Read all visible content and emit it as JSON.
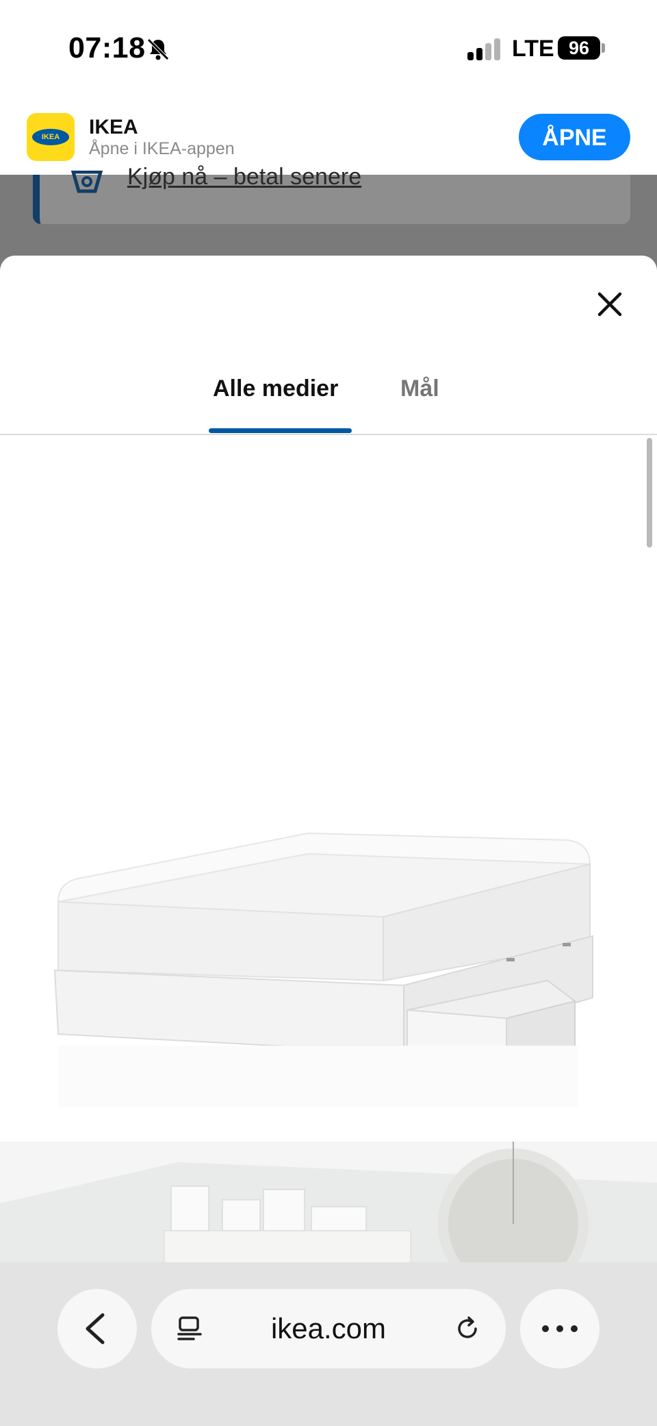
{
  "status_bar": {
    "time": "07:18",
    "network": "LTE",
    "battery": "96"
  },
  "app_banner": {
    "name": "IKEA",
    "subtitle": "Åpne i IKEA-appen",
    "open_label": "ÅPNE",
    "icon_text": "IKEA"
  },
  "background_page": {
    "link_text": "Kjøp nå – betal senere"
  },
  "modal": {
    "tabs": [
      {
        "label": "Alle medier",
        "active": true
      },
      {
        "label": "Mål",
        "active": false
      }
    ]
  },
  "browser": {
    "url": "ikea.com"
  },
  "colors": {
    "accent": "#0058a3",
    "open_button": "#0a84ff",
    "ikea_yellow": "#ffda1a"
  }
}
